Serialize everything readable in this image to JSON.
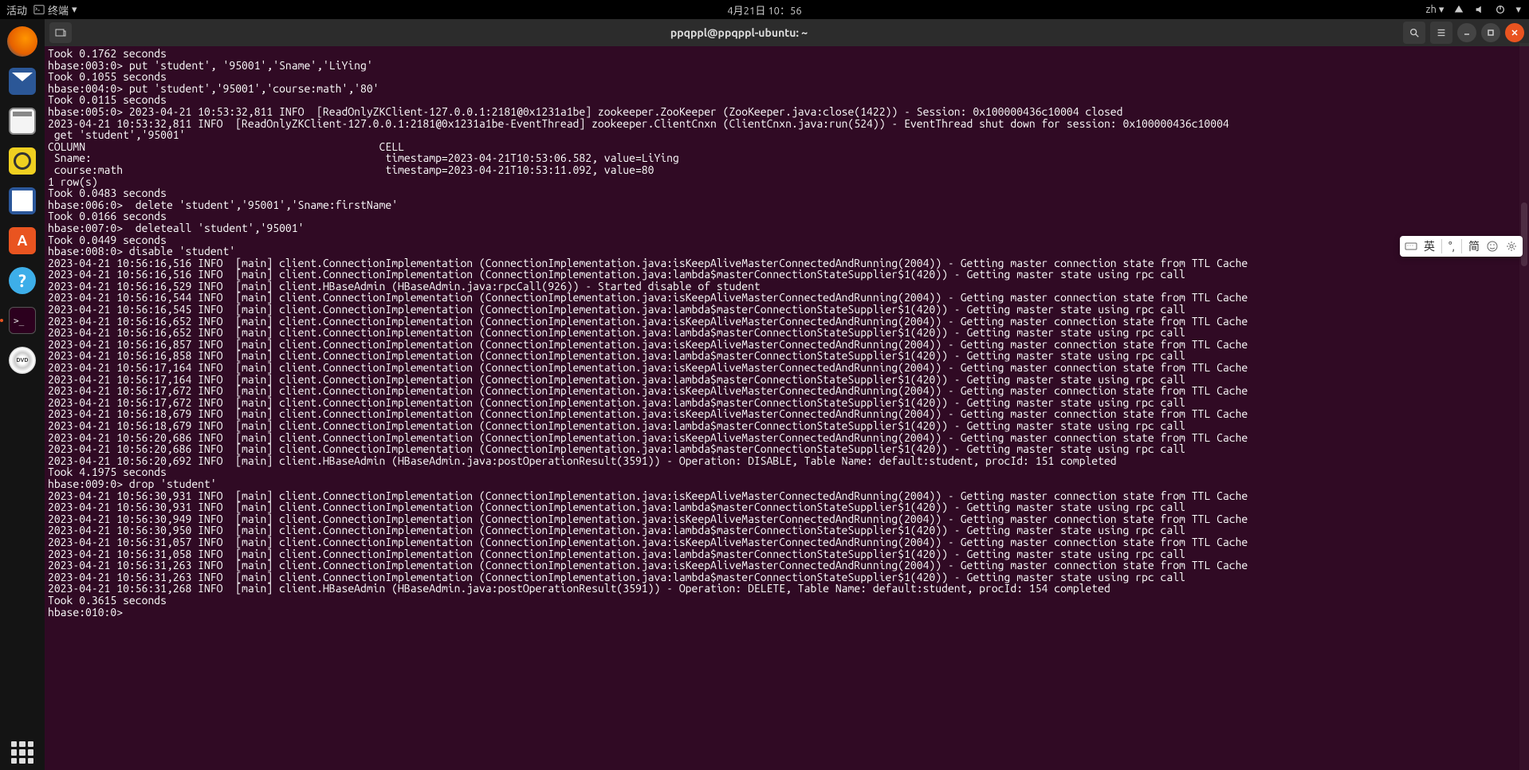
{
  "top_panel": {
    "activities": "活动",
    "app_name": "终端",
    "datetime": "4月21日 10：56",
    "lang": "zh"
  },
  "window": {
    "title": "ppqppl@ppqppl-ubuntu: ~"
  },
  "ime": {
    "lang": "英",
    "mode": "简"
  },
  "terminal_text": "Took 0.1762 seconds\nhbase:003:0> put 'student', '95001','Sname','LiYing'\nTook 0.1055 seconds\nhbase:004:0> put 'student','95001','course:math','80'\nTook 0.0115 seconds\nhbase:005:0> 2023-04-21 10:53:32,811 INFO  [ReadOnlyZKClient-127.0.0.1:2181@0x1231a1be] zookeeper.ZooKeeper (ZooKeeper.java:close(1422)) - Session: 0x100000436c10004 closed\n2023-04-21 10:53:32,811 INFO  [ReadOnlyZKClient-127.0.0.1:2181@0x1231a1be-EventThread] zookeeper.ClientCnxn (ClientCnxn.java:run(524)) - EventThread shut down for session: 0x100000436c10004\n get 'student','95001'\nCOLUMN                                               CELL\n Sname:                                               timestamp=2023-04-21T10:53:06.582, value=LiYing\n course:math                                          timestamp=2023-04-21T10:53:11.092, value=80\n1 row(s)\nTook 0.0483 seconds\nhbase:006:0>  delete 'student','95001','Sname:firstName'\nTook 0.0166 seconds\nhbase:007:0>  deleteall 'student','95001'\nTook 0.0449 seconds\nhbase:008:0> disable 'student'\n2023-04-21 10:56:16,516 INFO  [main] client.ConnectionImplementation (ConnectionImplementation.java:isKeepAliveMasterConnectedAndRunning(2004)) - Getting master connection state from TTL Cache\n2023-04-21 10:56:16,516 INFO  [main] client.ConnectionImplementation (ConnectionImplementation.java:lambda$masterConnectionStateSupplier$1(420)) - Getting master state using rpc call\n2023-04-21 10:56:16,529 INFO  [main] client.HBaseAdmin (HBaseAdmin.java:rpcCall(926)) - Started disable of student\n2023-04-21 10:56:16,544 INFO  [main] client.ConnectionImplementation (ConnectionImplementation.java:isKeepAliveMasterConnectedAndRunning(2004)) - Getting master connection state from TTL Cache\n2023-04-21 10:56:16,545 INFO  [main] client.ConnectionImplementation (ConnectionImplementation.java:lambda$masterConnectionStateSupplier$1(420)) - Getting master state using rpc call\n2023-04-21 10:56:16,652 INFO  [main] client.ConnectionImplementation (ConnectionImplementation.java:isKeepAliveMasterConnectedAndRunning(2004)) - Getting master connection state from TTL Cache\n2023-04-21 10:56:16,652 INFO  [main] client.ConnectionImplementation (ConnectionImplementation.java:lambda$masterConnectionStateSupplier$1(420)) - Getting master state using rpc call\n2023-04-21 10:56:16,857 INFO  [main] client.ConnectionImplementation (ConnectionImplementation.java:isKeepAliveMasterConnectedAndRunning(2004)) - Getting master connection state from TTL Cache\n2023-04-21 10:56:16,858 INFO  [main] client.ConnectionImplementation (ConnectionImplementation.java:lambda$masterConnectionStateSupplier$1(420)) - Getting master state using rpc call\n2023-04-21 10:56:17,164 INFO  [main] client.ConnectionImplementation (ConnectionImplementation.java:isKeepAliveMasterConnectedAndRunning(2004)) - Getting master connection state from TTL Cache\n2023-04-21 10:56:17,164 INFO  [main] client.ConnectionImplementation (ConnectionImplementation.java:lambda$masterConnectionStateSupplier$1(420)) - Getting master state using rpc call\n2023-04-21 10:56:17,672 INFO  [main] client.ConnectionImplementation (ConnectionImplementation.java:isKeepAliveMasterConnectedAndRunning(2004)) - Getting master connection state from TTL Cache\n2023-04-21 10:56:17,672 INFO  [main] client.ConnectionImplementation (ConnectionImplementation.java:lambda$masterConnectionStateSupplier$1(420)) - Getting master state using rpc call\n2023-04-21 10:56:18,679 INFO  [main] client.ConnectionImplementation (ConnectionImplementation.java:isKeepAliveMasterConnectedAndRunning(2004)) - Getting master connection state from TTL Cache\n2023-04-21 10:56:18,679 INFO  [main] client.ConnectionImplementation (ConnectionImplementation.java:lambda$masterConnectionStateSupplier$1(420)) - Getting master state using rpc call\n2023-04-21 10:56:20,686 INFO  [main] client.ConnectionImplementation (ConnectionImplementation.java:isKeepAliveMasterConnectedAndRunning(2004)) - Getting master connection state from TTL Cache\n2023-04-21 10:56:20,686 INFO  [main] client.ConnectionImplementation (ConnectionImplementation.java:lambda$masterConnectionStateSupplier$1(420)) - Getting master state using rpc call\n2023-04-21 10:56:20,692 INFO  [main] client.HBaseAdmin (HBaseAdmin.java:postOperationResult(3591)) - Operation: DISABLE, Table Name: default:student, procId: 151 completed\nTook 4.1975 seconds\nhbase:009:0> drop 'student'\n2023-04-21 10:56:30,931 INFO  [main] client.ConnectionImplementation (ConnectionImplementation.java:isKeepAliveMasterConnectedAndRunning(2004)) - Getting master connection state from TTL Cache\n2023-04-21 10:56:30,931 INFO  [main] client.ConnectionImplementation (ConnectionImplementation.java:lambda$masterConnectionStateSupplier$1(420)) - Getting master state using rpc call\n2023-04-21 10:56:30,949 INFO  [main] client.ConnectionImplementation (ConnectionImplementation.java:isKeepAliveMasterConnectedAndRunning(2004)) - Getting master connection state from TTL Cache\n2023-04-21 10:56:30,950 INFO  [main] client.ConnectionImplementation (ConnectionImplementation.java:lambda$masterConnectionStateSupplier$1(420)) - Getting master state using rpc call\n2023-04-21 10:56:31,057 INFO  [main] client.ConnectionImplementation (ConnectionImplementation.java:isKeepAliveMasterConnectedAndRunning(2004)) - Getting master connection state from TTL Cache\n2023-04-21 10:56:31,058 INFO  [main] client.ConnectionImplementation (ConnectionImplementation.java:lambda$masterConnectionStateSupplier$1(420)) - Getting master state using rpc call\n2023-04-21 10:56:31,263 INFO  [main] client.ConnectionImplementation (ConnectionImplementation.java:isKeepAliveMasterConnectedAndRunning(2004)) - Getting master connection state from TTL Cache\n2023-04-21 10:56:31,263 INFO  [main] client.ConnectionImplementation (ConnectionImplementation.java:lambda$masterConnectionStateSupplier$1(420)) - Getting master state using rpc call\n2023-04-21 10:56:31,268 INFO  [main] client.HBaseAdmin (HBaseAdmin.java:postOperationResult(3591)) - Operation: DELETE, Table Name: default:student, procId: 154 completed\nTook 0.3615 seconds\nhbase:010:0>"
}
